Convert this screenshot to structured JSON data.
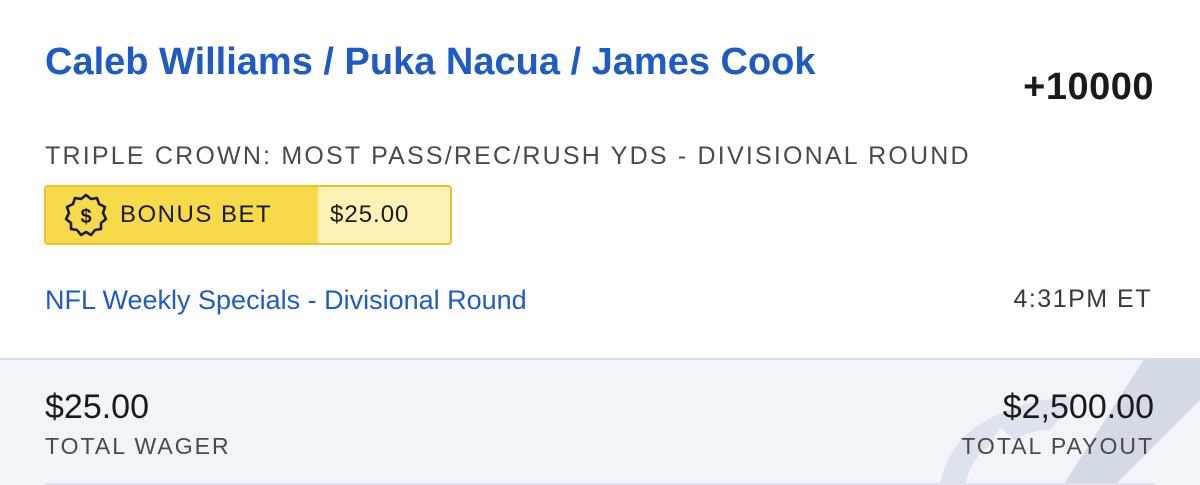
{
  "bet": {
    "selection": "Caleb Williams / Puka Nacua / James Cook",
    "odds": "+10000",
    "market": "TRIPLE CROWN: MOST PASS/REC/RUSH YDS - DIVISIONAL ROUND",
    "bonus_label": "BONUS BET",
    "bonus_amount": "$25.00",
    "league_link": "NFL Weekly Specials - Divisional Round",
    "time": "4:31PM ET"
  },
  "summary": {
    "wager_amount": "$25.00",
    "wager_label": "TOTAL WAGER",
    "payout_amount": "$2,500.00",
    "payout_label": "TOTAL PAYOUT"
  },
  "colors": {
    "link_blue": "#1f5bc6",
    "bonus_yellow": "#f6da4a",
    "bonus_light": "#fcf2b6",
    "summary_bg": "#f1f4f9"
  },
  "icons": {
    "bonus": "dollar-badge-icon",
    "watermark": "brand-watermark-icon"
  }
}
